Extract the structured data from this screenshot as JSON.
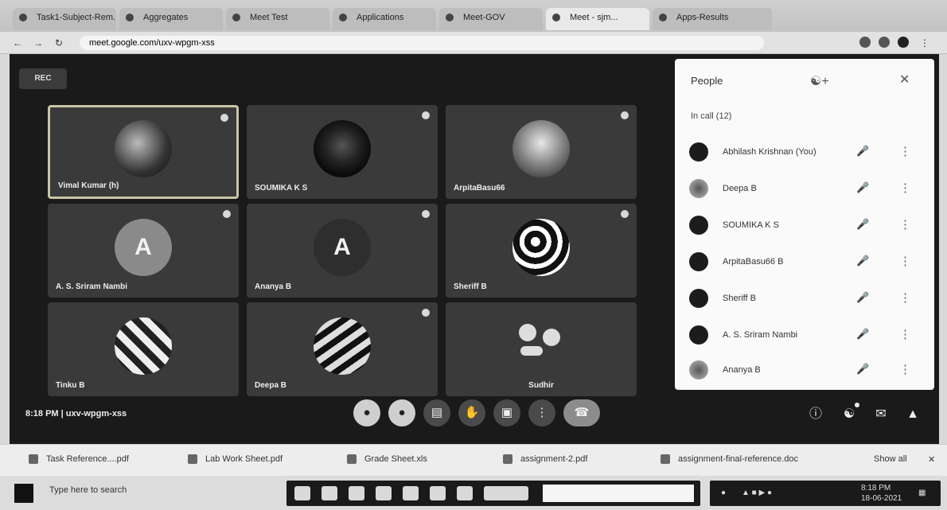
{
  "browser": {
    "tabs": [
      {
        "label": "Task1-Subject-Rem..."
      },
      {
        "label": "Aggregates"
      },
      {
        "label": "Meet Test"
      },
      {
        "label": "Applications"
      },
      {
        "label": "Meet-GOV"
      },
      {
        "label": "Meet - sjm..."
      },
      {
        "label": "Apps-Results"
      }
    ],
    "url": "meet.google.com/uxv-wpgm-xss"
  },
  "meet": {
    "logo": "REC",
    "tiles": [
      {
        "name": "Vimal Kumar (h)"
      },
      {
        "name": "SOUMIKA K S"
      },
      {
        "name": "ArpitaBasu66"
      },
      {
        "name": "A. S. Sriram Nambi",
        "letter": "A"
      },
      {
        "name": "Ananya B",
        "letter": "A"
      },
      {
        "name": "Sheriff B"
      },
      {
        "name": "Tinku B"
      },
      {
        "name": "Deepa B"
      },
      {
        "name": "Sudhir"
      }
    ],
    "meeting_info": "8:18 PM  |  uxv-wpgm-xss",
    "controls": [
      "mic",
      "camera",
      "captions",
      "raise-hand",
      "present",
      "more",
      "leave"
    ]
  },
  "people": {
    "title": "People",
    "count_label": "In call (12)",
    "participants": [
      {
        "name": "Abhilash Krishnan (You)"
      },
      {
        "name": "Deepa B"
      },
      {
        "name": "SOUMIKA K S"
      },
      {
        "name": "ArpitaBasu66 B"
      },
      {
        "name": "Sheriff B"
      },
      {
        "name": "A. S. Sriram Nambi"
      },
      {
        "name": "Ananya B"
      }
    ]
  },
  "downloads": [
    {
      "label": "Task Reference....pdf"
    },
    {
      "label": "Lab Work Sheet.pdf"
    },
    {
      "label": "Grade Sheet.xls"
    },
    {
      "label": "assignment-2.pdf"
    },
    {
      "label": "assignment-final-reference.doc"
    }
  ],
  "downloads_show_all": "Show all",
  "taskbar": {
    "search_placeholder": "Type here to search",
    "time": "8:18 PM",
    "date": "18-06-2021"
  }
}
